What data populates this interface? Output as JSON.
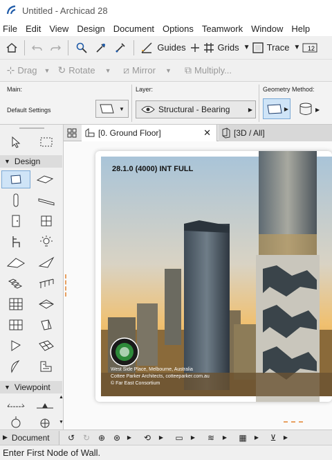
{
  "window": {
    "title": "Untitled - Archicad 28"
  },
  "menu": [
    "File",
    "Edit",
    "View",
    "Design",
    "Document",
    "Options",
    "Teamwork",
    "Window",
    "Help"
  ],
  "toolbar": {
    "guides_label": "Guides",
    "grids_label": "Grids",
    "trace_label": "Trace",
    "drag_label": "Drag",
    "rotate_label": "Rotate",
    "mirror_label": "Mirror",
    "multiply_label": "Multiply..."
  },
  "infobox": {
    "main_label": "Main:",
    "default_settings": "Default Settings",
    "layer_label": "Layer:",
    "layer_value": "Structural - Bearing",
    "geometry_label": "Geometry Method:"
  },
  "toolbox": {
    "design_header": "Design",
    "viewpoint_header": "Viewpoint"
  },
  "tabs": {
    "floor_plan": "[0. Ground Floor]",
    "three_d": "[3D / All]"
  },
  "splash": {
    "version": "28.1.0 (4000) INT FULL",
    "credit_line1": "West Side Place, Melbourne, Australia",
    "credit_line2": "Cottee Parker Architects, cotteeparker.com.au",
    "credit_line3": "© Far East Consortium"
  },
  "navigator": {
    "document_label": "Document"
  },
  "status": {
    "message": "Enter First Node of Wall."
  },
  "colors": {
    "accent": "#1e5aa8",
    "selected": "#cfe4f7"
  }
}
